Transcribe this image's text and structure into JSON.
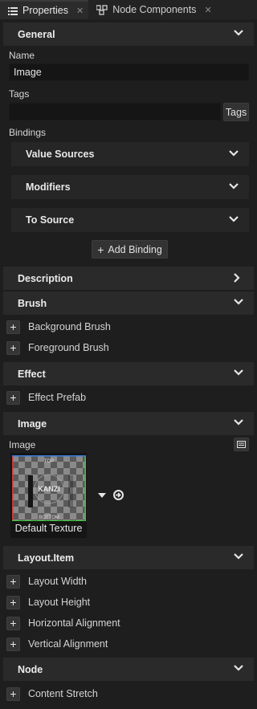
{
  "tabs": [
    {
      "label": "Properties",
      "icon": "list-icon",
      "active": true
    },
    {
      "label": "Node Components",
      "icon": "components-icon",
      "active": false
    }
  ],
  "general": {
    "title": "General",
    "name_label": "Name",
    "name_value": "Image",
    "tags_label": "Tags",
    "tags_button": "Tags",
    "bindings_label": "Bindings",
    "value_sources": "Value Sources",
    "modifiers": "Modifiers",
    "to_source": "To Source",
    "add_binding": "Add Binding"
  },
  "description": {
    "title": "Description"
  },
  "brush": {
    "title": "Brush",
    "items": [
      "Background Brush",
      "Foreground Brush"
    ]
  },
  "effect": {
    "title": "Effect",
    "items": [
      "Effect Prefab"
    ]
  },
  "image": {
    "title": "Image",
    "image_label": "Image",
    "texture_name": "Default Texture",
    "thumb_top": "TOP",
    "thumb_bottom": "BOTTOM",
    "thumb_logo": "KANZI"
  },
  "layout_item": {
    "title": "Layout.Item",
    "items": [
      "Layout Width",
      "Layout Height",
      "Horizontal Alignment",
      "Vertical Alignment"
    ]
  },
  "node": {
    "title": "Node",
    "items": [
      "Content Stretch"
    ]
  }
}
